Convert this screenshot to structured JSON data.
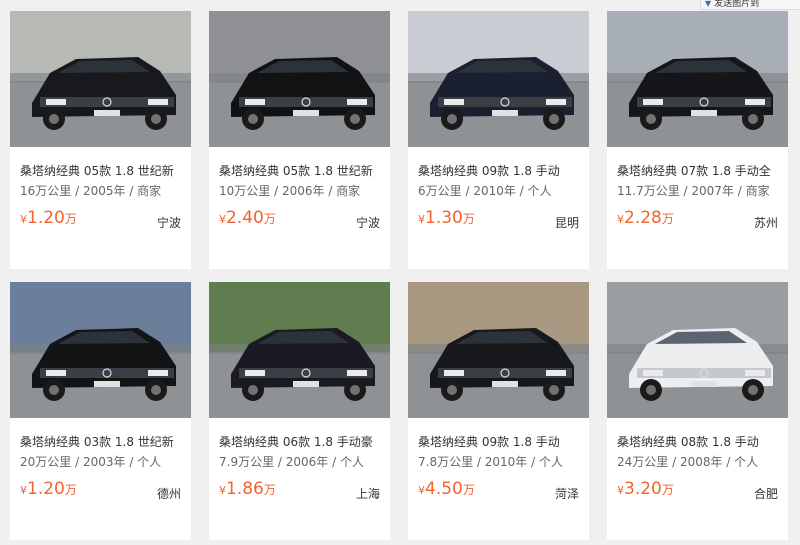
{
  "top_button": {
    "label": "发送图片到"
  },
  "listings": [
    {
      "title": "桑塔纳经典 05款 1.8 世纪新",
      "mileage": "16万公里",
      "year": "2005年",
      "seller": "商家",
      "currency": "¥",
      "price": "1.20",
      "unit": "万",
      "city": "宁波",
      "car_color": "#17191c",
      "bg_color": "#b7b9b4"
    },
    {
      "title": "桑塔纳经典 05款 1.8 世纪新",
      "mileage": "10万公里",
      "year": "2006年",
      "seller": "商家",
      "currency": "¥",
      "price": "2.40",
      "unit": "万",
      "city": "宁波",
      "car_color": "#101214",
      "bg_color": "#8e9093"
    },
    {
      "title": "桑塔纳经典 09款 1.8 手动",
      "mileage": "6万公里",
      "year": "2010年",
      "seller": "个人",
      "currency": "¥",
      "price": "1.30",
      "unit": "万",
      "city": "昆明",
      "car_color": "#1b2030",
      "bg_color": "#c9ccd2"
    },
    {
      "title": "桑塔纳经典 07款 1.8 手动全",
      "mileage": "11.7万公里",
      "year": "2007年",
      "seller": "商家",
      "currency": "¥",
      "price": "2.28",
      "unit": "万",
      "city": "苏州",
      "car_color": "#141619",
      "bg_color": "#a8aeb5"
    },
    {
      "title": "桑塔纳经典 03款 1.8 世纪新",
      "mileage": "20万公里",
      "year": "2003年",
      "seller": "个人",
      "currency": "¥",
      "price": "1.20",
      "unit": "万",
      "city": "德州",
      "car_color": "#121416",
      "bg_color": "#6b7f9a"
    },
    {
      "title": "桑塔纳经典 06款 1.8 手动豪",
      "mileage": "7.9万公里",
      "year": "2006年",
      "seller": "个人",
      "currency": "¥",
      "price": "1.86",
      "unit": "万",
      "city": "上海",
      "car_color": "#1b1a22",
      "bg_color": "#5f7d4f"
    },
    {
      "title": "桑塔纳经典 09款 1.8 手动",
      "mileage": "7.8万公里",
      "year": "2010年",
      "seller": "个人",
      "currency": "¥",
      "price": "4.50",
      "unit": "万",
      "city": "菏泽",
      "car_color": "#16181b",
      "bg_color": "#a99983"
    },
    {
      "title": "桑塔纳经典 08款 1.8 手动",
      "mileage": "24万公里",
      "year": "2008年",
      "seller": "个人",
      "currency": "¥",
      "price": "3.20",
      "unit": "万",
      "city": "合肥",
      "car_color": "#eceef0",
      "bg_color": "#9a9ea3"
    }
  ]
}
